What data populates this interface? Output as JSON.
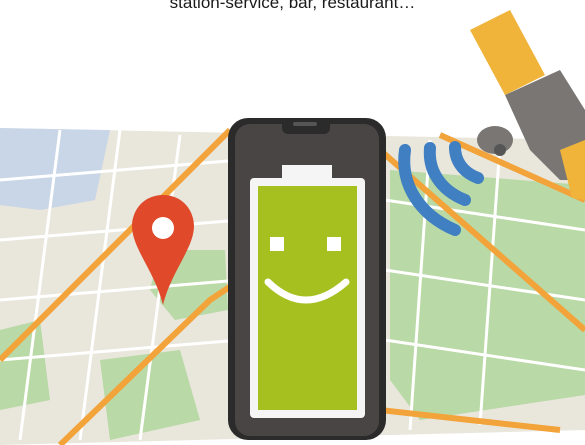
{
  "caption": "station-service, bar, restaurant…",
  "colors": {
    "map_land": "#e9e6dc",
    "park_green": "#b9d9a6",
    "road_orange": "#f2a33a",
    "road_white": "#ffffff",
    "water": "#a9c6f2",
    "pin_red": "#e04a2a",
    "phone_body": "#2b2b2b",
    "phone_screen": "#4a4545",
    "battery_frame": "#f5f5f5",
    "battery_fill": "#a6c020",
    "face_white": "#ffffff",
    "signal_blue": "#3f7fc2",
    "satellite_body": "#7a7674",
    "satellite_panel": "#f0b43a"
  },
  "icons": {
    "location_pin": "location-pin-icon",
    "battery_face": "smiling-battery-icon",
    "satellite": "satellite-icon",
    "signal_waves": "signal-waves-icon"
  }
}
